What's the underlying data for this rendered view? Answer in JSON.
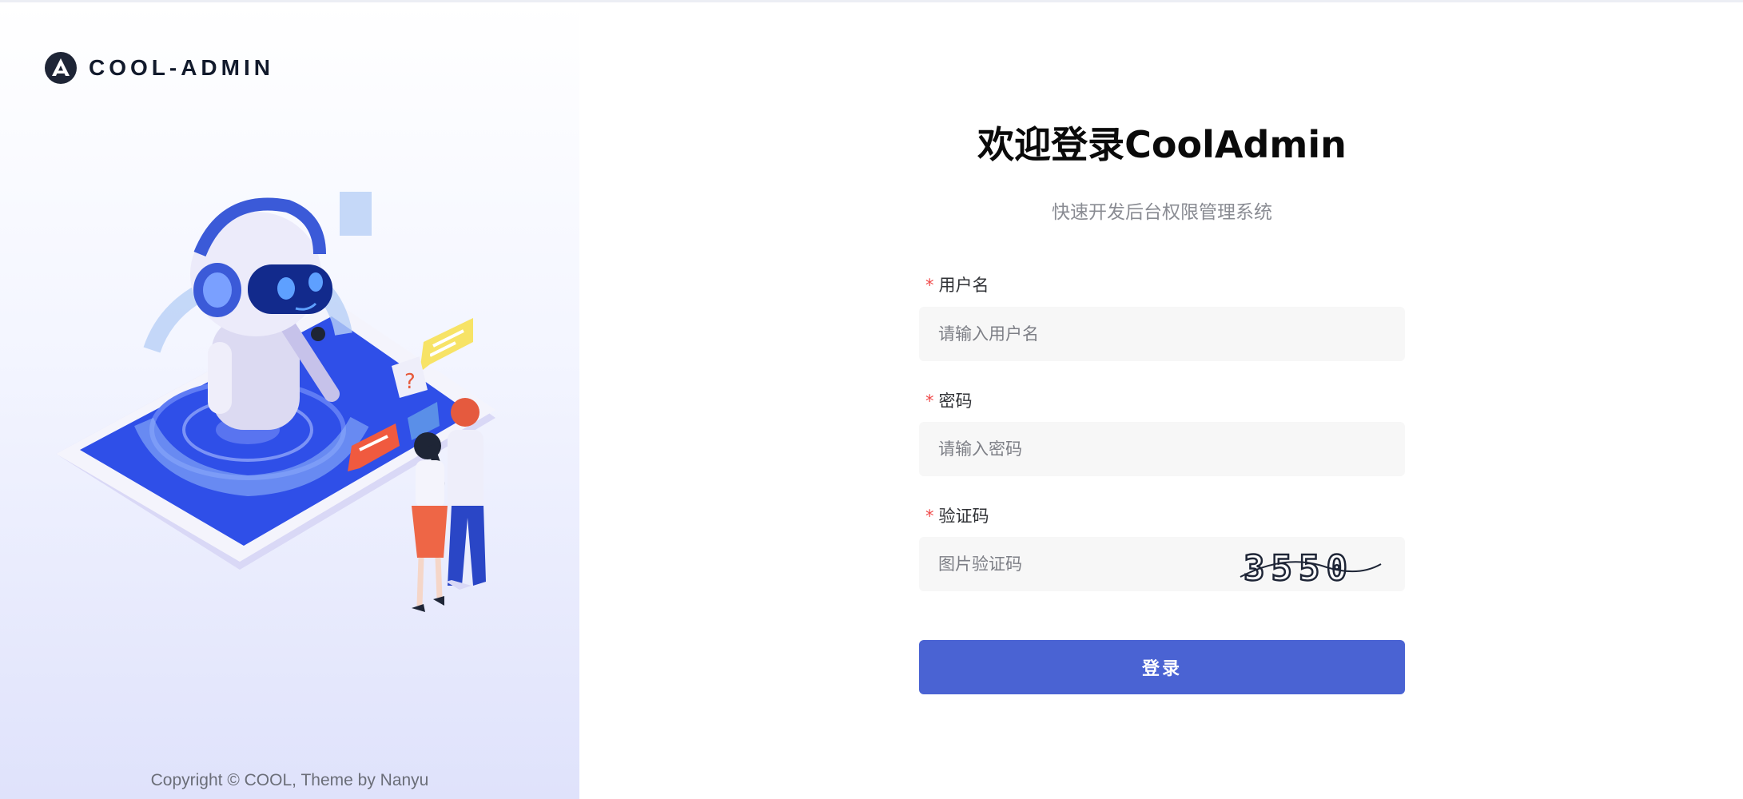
{
  "brand": {
    "name": "COOL-ADMIN"
  },
  "footer": {
    "copyright": "Copyright © COOL, Theme by Nanyu"
  },
  "login": {
    "title": "欢迎登录CoolAdmin",
    "subtitle": "快速开发后台权限管理系统",
    "username": {
      "label": "用户名",
      "placeholder": "请输入用户名",
      "value": ""
    },
    "password": {
      "label": "密码",
      "placeholder": "请输入密码",
      "value": ""
    },
    "captcha": {
      "label": "验证码",
      "placeholder": "图片验证码",
      "value": "",
      "image_text": "3550"
    },
    "submit_label": "登录"
  },
  "colors": {
    "primary": "#4a63d3",
    "required": "#f04b4b",
    "field_bg": "#f7f7f7"
  }
}
